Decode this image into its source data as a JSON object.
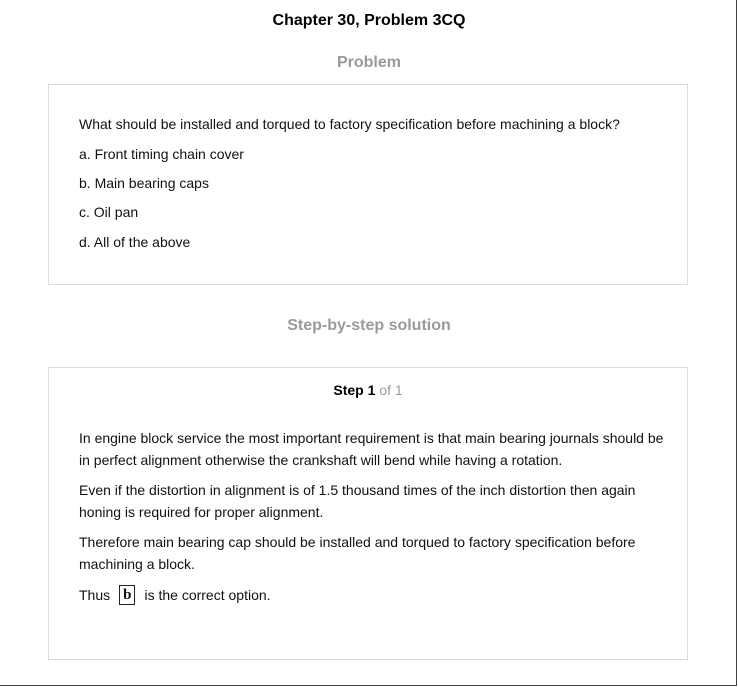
{
  "header": {
    "title": "Chapter 30, Problem 3CQ"
  },
  "problem": {
    "heading": "Problem",
    "question": "What should be installed and torqued to factory specification before machining a block?",
    "options": [
      "a. Front timing chain cover",
      "b. Main bearing caps",
      "c. Oil pan",
      "d. All of the above"
    ]
  },
  "solution": {
    "heading": "Step-by-step solution",
    "step_word": "Step",
    "step_number": "1",
    "step_total": "of 1",
    "paragraphs": [
      "In engine block service the most important requirement is that main bearing journals should be in perfect alignment otherwise the crankshaft will bend while having a rotation.",
      "Even if the distortion in alignment is of 1.5 thousand times of the inch distortion then again honing is required for proper alignment.",
      "Therefore main bearing cap should be installed and torqued to factory specification before machining a block."
    ],
    "answer_prefix": "Thus",
    "answer_value": "b",
    "answer_suffix": "is the correct option."
  }
}
